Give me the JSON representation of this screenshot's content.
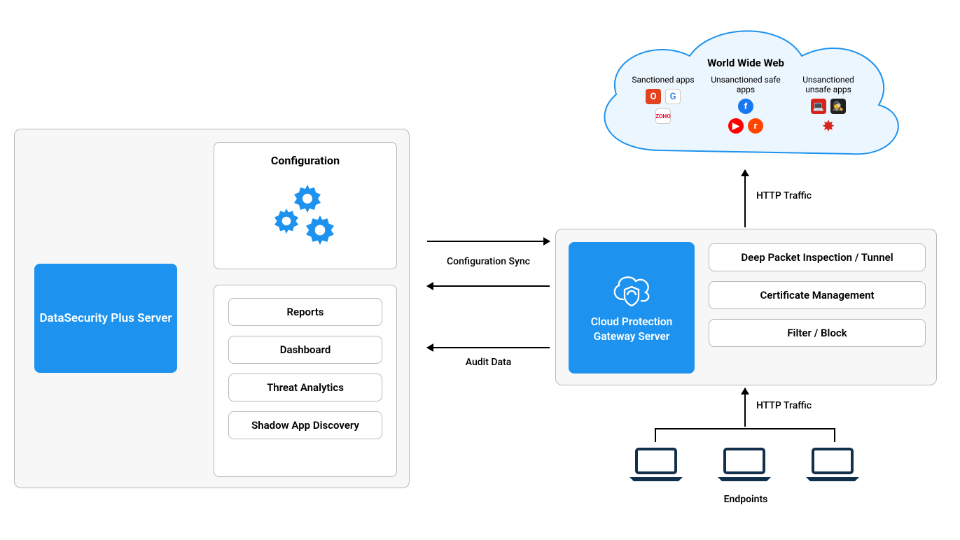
{
  "left_panel": {
    "dsp_title": "DataSecurity Plus Server",
    "configuration_title": "Configuration",
    "report_items": [
      "Reports",
      "Dashboard",
      "Threat Analytics",
      "Shadow App Discovery"
    ]
  },
  "connectors": {
    "config_sync": "Configuration Sync",
    "audit_data": "Audit Data",
    "http_traffic": "HTTP Traffic"
  },
  "gateway": {
    "title": "Cloud Protection Gateway Server",
    "features": [
      "Deep Packet Inspection / Tunnel",
      "Certificate Management",
      "Filter / Block"
    ]
  },
  "cloud": {
    "title": "World Wide Web",
    "columns": [
      {
        "label": "Sanctioned apps",
        "icons": [
          "office",
          "google",
          "zoho"
        ]
      },
      {
        "label": "Unsanctioned safe apps",
        "icons": [
          "facebook",
          "youtube",
          "reddit"
        ]
      },
      {
        "label": "Unsanctioned unsafe apps",
        "icons": [
          "malware-laptop",
          "hacker",
          "virus"
        ]
      }
    ]
  },
  "endpoints_label": "Endpoints"
}
